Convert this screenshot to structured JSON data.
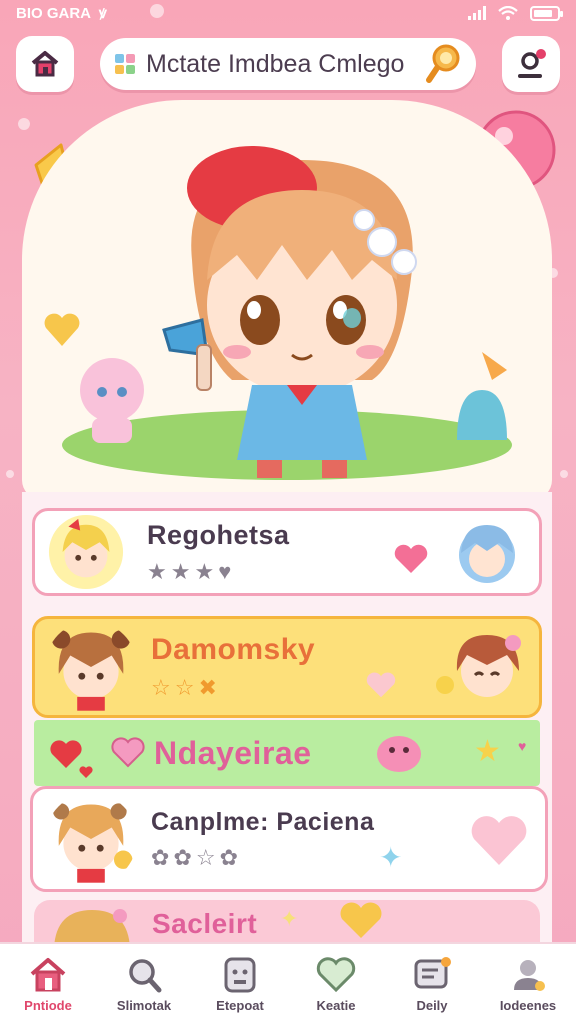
{
  "status_bar": {
    "carrier": "BIO GARA",
    "symbol": "ꝟ",
    "battery_level": 0.8
  },
  "header": {
    "search_text": "Mctate Imdbea Cmlego",
    "icons": {
      "home": "home-icon",
      "search": "magnifier-icon",
      "profile": "profile-icon",
      "grid": "grid-icon"
    },
    "accent": "#f6b84a"
  },
  "cards": [
    {
      "title": "Regohetsa",
      "stars_filled": 3,
      "stars_total": 4,
      "title_color": "#4a3b4f",
      "bg": "#ffffff"
    },
    {
      "title": "Damomsky",
      "stars_filled": 2,
      "stars_total": 3,
      "title_color": "#e8703a",
      "bg": "#fde07a"
    },
    {
      "title": "Ndayeirae",
      "title_color": "#e0609a",
      "bg": "#b9eda0"
    },
    {
      "title": "Canplme: Paciena",
      "stars_filled": 0,
      "stars_total": 4,
      "title_color": "#4a3b4f",
      "bg": "#ffffff"
    },
    {
      "title": "Sacleirt",
      "title_color": "#e0609a",
      "bg": "#fbc9d6"
    }
  ],
  "bottom_nav": [
    {
      "label": "Pntiode",
      "icon": "home-icon",
      "active": true
    },
    {
      "label": "Slimotak",
      "icon": "magnifier-icon",
      "active": false
    },
    {
      "label": "Etepoat",
      "icon": "face-icon",
      "active": false
    },
    {
      "label": "Keatie",
      "icon": "heart-icon",
      "active": false
    },
    {
      "label": "Deily",
      "icon": "message-icon",
      "active": false
    },
    {
      "label": "Iodeenes",
      "icon": "user-icon",
      "active": false
    }
  ]
}
